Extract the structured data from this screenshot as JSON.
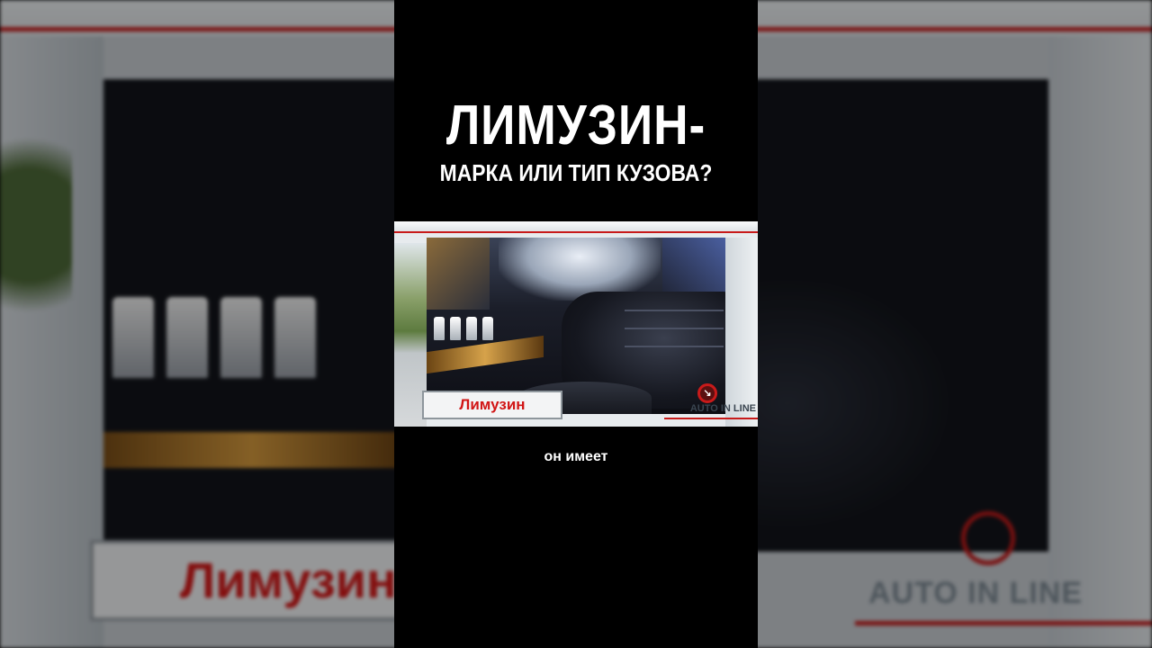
{
  "video": {
    "title_line1": "ЛИМУЗИН-",
    "title_line2": "МАРКА ИЛИ ТИП КУЗОВА?",
    "caption": "он имеет"
  },
  "frame": {
    "label": "Лимузин",
    "brand": "AUTO IN LINE",
    "logo_glyph": "↘"
  },
  "backdrop": {
    "label": "Лимузин",
    "brand": "AUTO IN LINE"
  },
  "colors": {
    "accent_red": "#c81a1a",
    "label_red": "#d11515",
    "background": "#000000"
  }
}
